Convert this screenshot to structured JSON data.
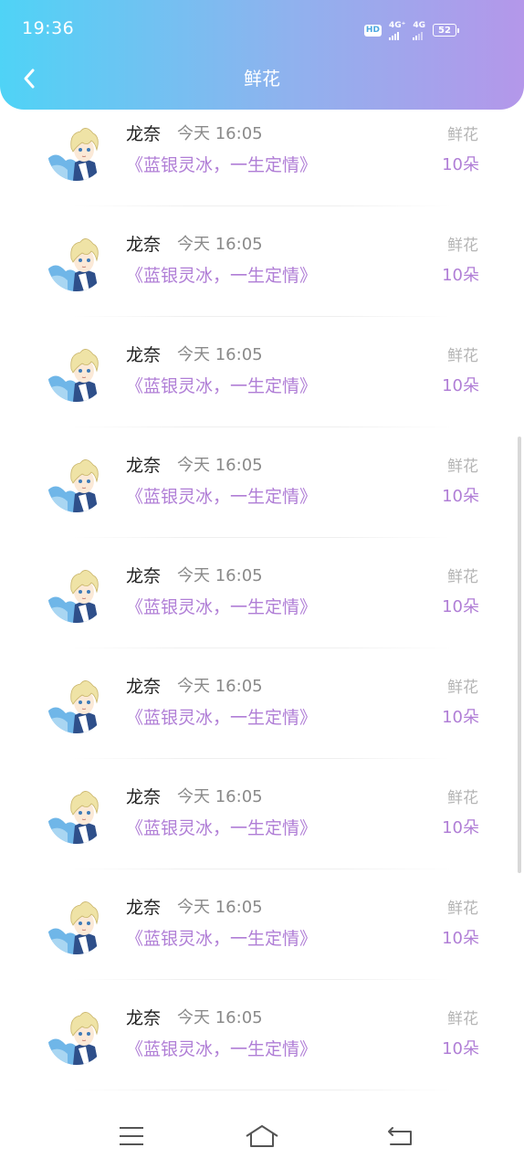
{
  "status_bar": {
    "time": "19:36",
    "hd_badge": "HD",
    "network_1": "4G⁺",
    "network_2": "4G",
    "battery": "52"
  },
  "header": {
    "back_icon": "chevron-left-icon",
    "title": "鲜花",
    "gradient_colors": [
      "#4fd3f6",
      "#b497ea"
    ]
  },
  "list": {
    "items": [
      {
        "name": "龙奈",
        "time": "今天 16:05",
        "gift_title": "《蓝银灵冰，一生定情》",
        "gift_type": "鲜花",
        "gift_count": "10朵"
      },
      {
        "name": "龙奈",
        "time": "今天 16:05",
        "gift_title": "《蓝银灵冰，一生定情》",
        "gift_type": "鲜花",
        "gift_count": "10朵"
      },
      {
        "name": "龙奈",
        "time": "今天 16:05",
        "gift_title": "《蓝银灵冰，一生定情》",
        "gift_type": "鲜花",
        "gift_count": "10朵"
      },
      {
        "name": "龙奈",
        "time": "今天 16:05",
        "gift_title": "《蓝银灵冰，一生定情》",
        "gift_type": "鲜花",
        "gift_count": "10朵"
      },
      {
        "name": "龙奈",
        "time": "今天 16:05",
        "gift_title": "《蓝银灵冰，一生定情》",
        "gift_type": "鲜花",
        "gift_count": "10朵"
      },
      {
        "name": "龙奈",
        "time": "今天 16:05",
        "gift_title": "《蓝银灵冰，一生定情》",
        "gift_type": "鲜花",
        "gift_count": "10朵"
      },
      {
        "name": "龙奈",
        "time": "今天 16:05",
        "gift_title": "《蓝银灵冰，一生定情》",
        "gift_type": "鲜花",
        "gift_count": "10朵"
      },
      {
        "name": "龙奈",
        "time": "今天 16:05",
        "gift_title": "《蓝银灵冰，一生定情》",
        "gift_type": "鲜花",
        "gift_count": "10朵"
      },
      {
        "name": "龙奈",
        "time": "今天 16:05",
        "gift_title": "《蓝银灵冰，一生定情》",
        "gift_type": "鲜花",
        "gift_count": "10朵"
      }
    ],
    "accent_color": "#b07ed6"
  },
  "nav_bar": {
    "menu_icon": "menu-icon",
    "home_icon": "home-icon",
    "back_icon": "back-icon"
  }
}
